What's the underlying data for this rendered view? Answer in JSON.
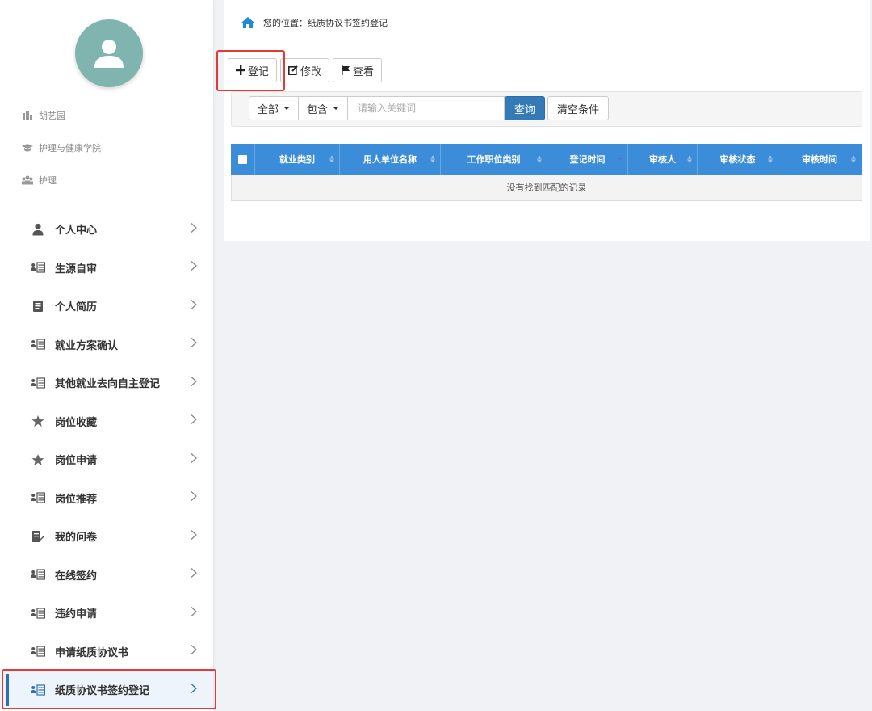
{
  "profile": {
    "name": "胡艺园",
    "college": "护理与健康学院",
    "major": "护理"
  },
  "menu": [
    {
      "label": "个人中心",
      "icon": "user-icon"
    },
    {
      "label": "生源自审",
      "icon": "id-card-icon"
    },
    {
      "label": "个人简历",
      "icon": "document-icon"
    },
    {
      "label": "就业方案确认",
      "icon": "id-card-icon"
    },
    {
      "label": "其他就业去向自主登记",
      "icon": "id-card-icon"
    },
    {
      "label": "岗位收藏",
      "icon": "star-icon"
    },
    {
      "label": "岗位申请",
      "icon": "star-icon"
    },
    {
      "label": "岗位推荐",
      "icon": "id-card-icon"
    },
    {
      "label": "我的问卷",
      "icon": "edit-doc-icon"
    },
    {
      "label": "在线签约",
      "icon": "id-card-icon"
    },
    {
      "label": "违约申请",
      "icon": "id-card-icon"
    },
    {
      "label": "申请纸质协议书",
      "icon": "id-card-icon"
    },
    {
      "label": "纸质协议书签约登记",
      "icon": "id-card-icon",
      "active": true
    }
  ],
  "breadcrumb": {
    "prefix": "您的位置：",
    "current": "纸质协议书签约登记"
  },
  "toolbar": {
    "register": "登记",
    "edit": "修改",
    "view": "查看"
  },
  "search": {
    "scope": "全部",
    "mode": "包含",
    "placeholder": "请输入关键词",
    "query": "查询",
    "clear": "清空条件"
  },
  "table": {
    "columns": [
      "就业类别",
      "用人单位名称",
      "工作职位类别",
      "登记时间",
      "审核人",
      "审核状态",
      "审核时间"
    ],
    "sorted_column": "登记时间",
    "sort_direction": "desc",
    "empty_text": "没有找到匹配的记录"
  },
  "colors": {
    "accent": "#337ab7",
    "table_header": "#3c8dd9",
    "highlight": "#e53935",
    "avatar": "#7fb5ae"
  }
}
